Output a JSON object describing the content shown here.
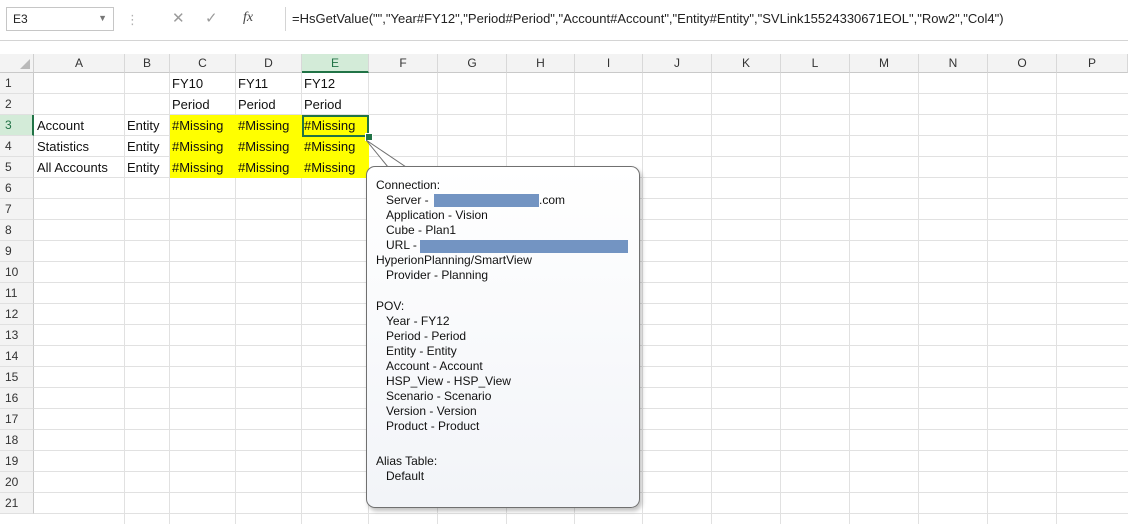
{
  "formula_bar": {
    "name_box": "E3",
    "name_box_arrow": "▼",
    "separator": "⋮",
    "cancel": "✕",
    "enter": "✓",
    "fx": "fx",
    "formula": "=HsGetValue(\"\",\"Year#FY12\",\"Period#Period\",\"Account#Account\",\"Entity#Entity\",\"SVLink15524330671EOL\",\"Row2\",\"Col4\")"
  },
  "columns": [
    "A",
    "B",
    "C",
    "D",
    "E",
    "F",
    "G",
    "H",
    "I",
    "J",
    "K",
    "L",
    "M",
    "N",
    "O",
    "P"
  ],
  "rows": [
    "1",
    "2",
    "3",
    "4",
    "5",
    "6",
    "7",
    "8",
    "9",
    "10",
    "11",
    "12",
    "13",
    "14",
    "15",
    "16",
    "17",
    "18",
    "19",
    "20",
    "21"
  ],
  "cells": {
    "C1": "FY10",
    "D1": "FY11",
    "E1": "FY12",
    "C2": "Period",
    "D2": "Period",
    "E2": "Period",
    "A3": "Account",
    "B3": "Entity",
    "C3": "#Missing",
    "D3": "#Missing",
    "E3": "#Missing",
    "A4": "Statistics",
    "B4": "Entity",
    "C4": "#Missing",
    "D4": "#Missing",
    "E4": "#Missing",
    "A5": "All Accounts",
    "B5": "Entity",
    "C5": "#Missing",
    "D5": "#Missing",
    "E5": "#Missing"
  },
  "highlight_color": "#ffff00",
  "selection_color": "#217346",
  "comment": {
    "connection_label": "Connection:",
    "server_prefix": "Server -",
    "server_suffix": ".com",
    "application": "Application - Vision",
    "cube": "Cube - Plan1",
    "url_prefix": "URL -",
    "url_path": "HyperionPlanning/SmartView",
    "provider": "Provider - Planning",
    "pov_label": "POV:",
    "pov_items": [
      "Year - FY12",
      "Period - Period",
      "Entity - Entity",
      "Account - Account",
      "HSP_View - HSP_View",
      "Scenario - Scenario",
      "Version - Version",
      "Product - Product"
    ],
    "alias_label": "Alias Table:",
    "alias_value": "Default",
    "redaction_color": "#7394c2"
  }
}
